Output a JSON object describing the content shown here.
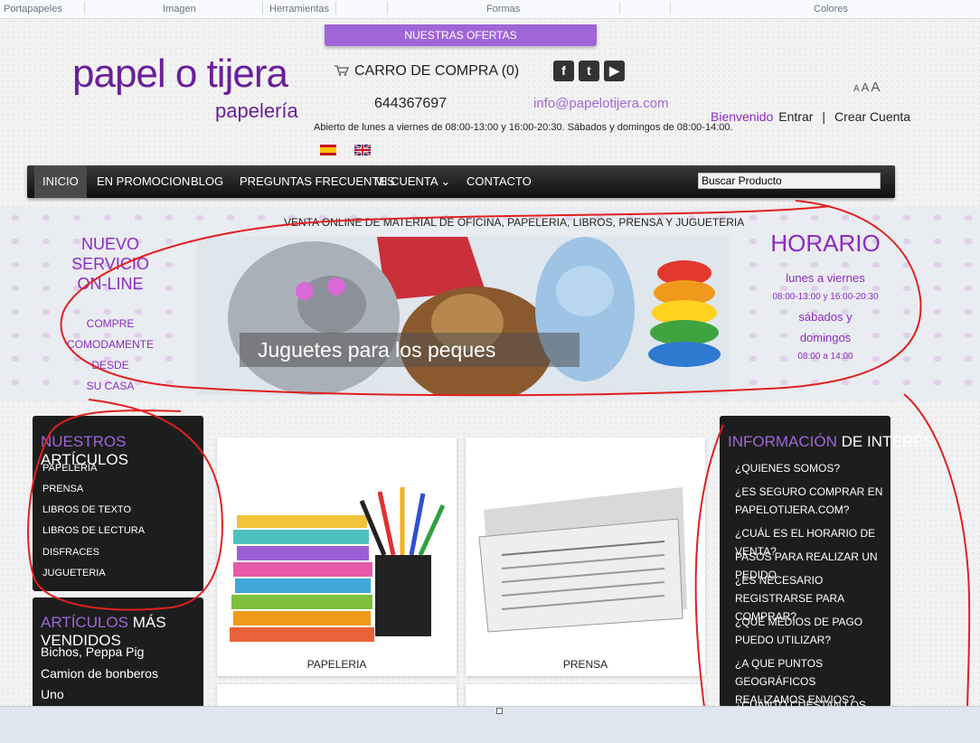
{
  "ribbon": {
    "groups": [
      "Portapapeles",
      "Imagen",
      "Herramientas",
      "Formas",
      "Colores"
    ]
  },
  "offers": {
    "label": "NUESTRAS OFERTAS"
  },
  "logo": {
    "main": "papel o tijera",
    "sub": "papelería"
  },
  "header": {
    "cart": "CARRO DE COMPRA (0)",
    "phone": "644367697",
    "email": "info@papelotijera.com",
    "hours": "Abierto de lunes a viernes de 08:00-13:00 y 16:00-20:30. Sábados y domingos de 08:00-14:00.",
    "social": [
      "f",
      "t",
      "▶"
    ],
    "font_sizes": [
      "A",
      "A",
      "A"
    ],
    "welcome": "Bienvenido",
    "login": "Entrar",
    "separator": "|",
    "register": "Crear Cuenta"
  },
  "nav": {
    "items": [
      "INICIO",
      "EN PROMOCION",
      "BLOG",
      "PREGUNTAS FRECUENTES",
      "MI CUENTA ⌄",
      "CONTACTO"
    ],
    "search_value": "Buscar Producto"
  },
  "band": {
    "tagline": "VENTA ONLINE DE MATERIAL DE OFICINA, PAPELERIA, LIBROS, PRENSA Y JUGUETERIA",
    "service_title": [
      "NUEVO SERVICIO",
      "ON-LINE"
    ],
    "service_lines": [
      "COMPRE",
      "COMODAMENTE",
      "DESDE",
      "SU CASA"
    ],
    "banner_caption": "Juguetes para los peques",
    "schedule_title": "HORARIO",
    "schedule": [
      "lunes a viernes",
      "08:00-13:00 y 16:00-20:30",
      "sábados y",
      "domingos",
      "08:00 a 14:00"
    ]
  },
  "articles": {
    "title_hl": "NUESTROS",
    "title_rest": " ARTÍCULOS",
    "items": [
      "PAPELERIA",
      "PRENSA",
      "LIBROS DE TEXTO",
      "LIBROS DE LECTURA",
      "DISFRACES",
      "JUGUETERIA"
    ]
  },
  "bestsellers": {
    "title_hl": "ARTÍCULOS",
    "title_rest": " MÁS VENDIDOS",
    "items": [
      "Bichos, Peppa Pig",
      "Camion de bonberos",
      "Uno"
    ]
  },
  "products": [
    {
      "label": "PAPELERIA"
    },
    {
      "label": "PRENSA"
    }
  ],
  "info": {
    "title_hl": "INFORMACIÓN",
    "title_rest": " DE INTERÉS",
    "items": [
      "¿QUIENES SOMOS?",
      "¿ES SEGURO COMPRAR EN PAPELOTIJERA.COM?",
      "¿CUÁL ES EL HORARIO DE VENTA?",
      "PASOS PARA REALIZAR UN PEDIDO",
      "¿ES NECESARIO REGISTRARSE PARA COMPRAR?",
      "¿QUÉ MEDIOS DE PAGO PUEDO UTILIZAR?",
      "¿A QUE PUNTOS GEOGRÁFICOS REALIZAMOS ENVIOS?",
      "¿CUÁNTO CUESTAN LOS GASTOS"
    ]
  },
  "colors": {
    "accent": "#a066d8",
    "brand": "#6a1f99",
    "annotation": "#e02020"
  }
}
